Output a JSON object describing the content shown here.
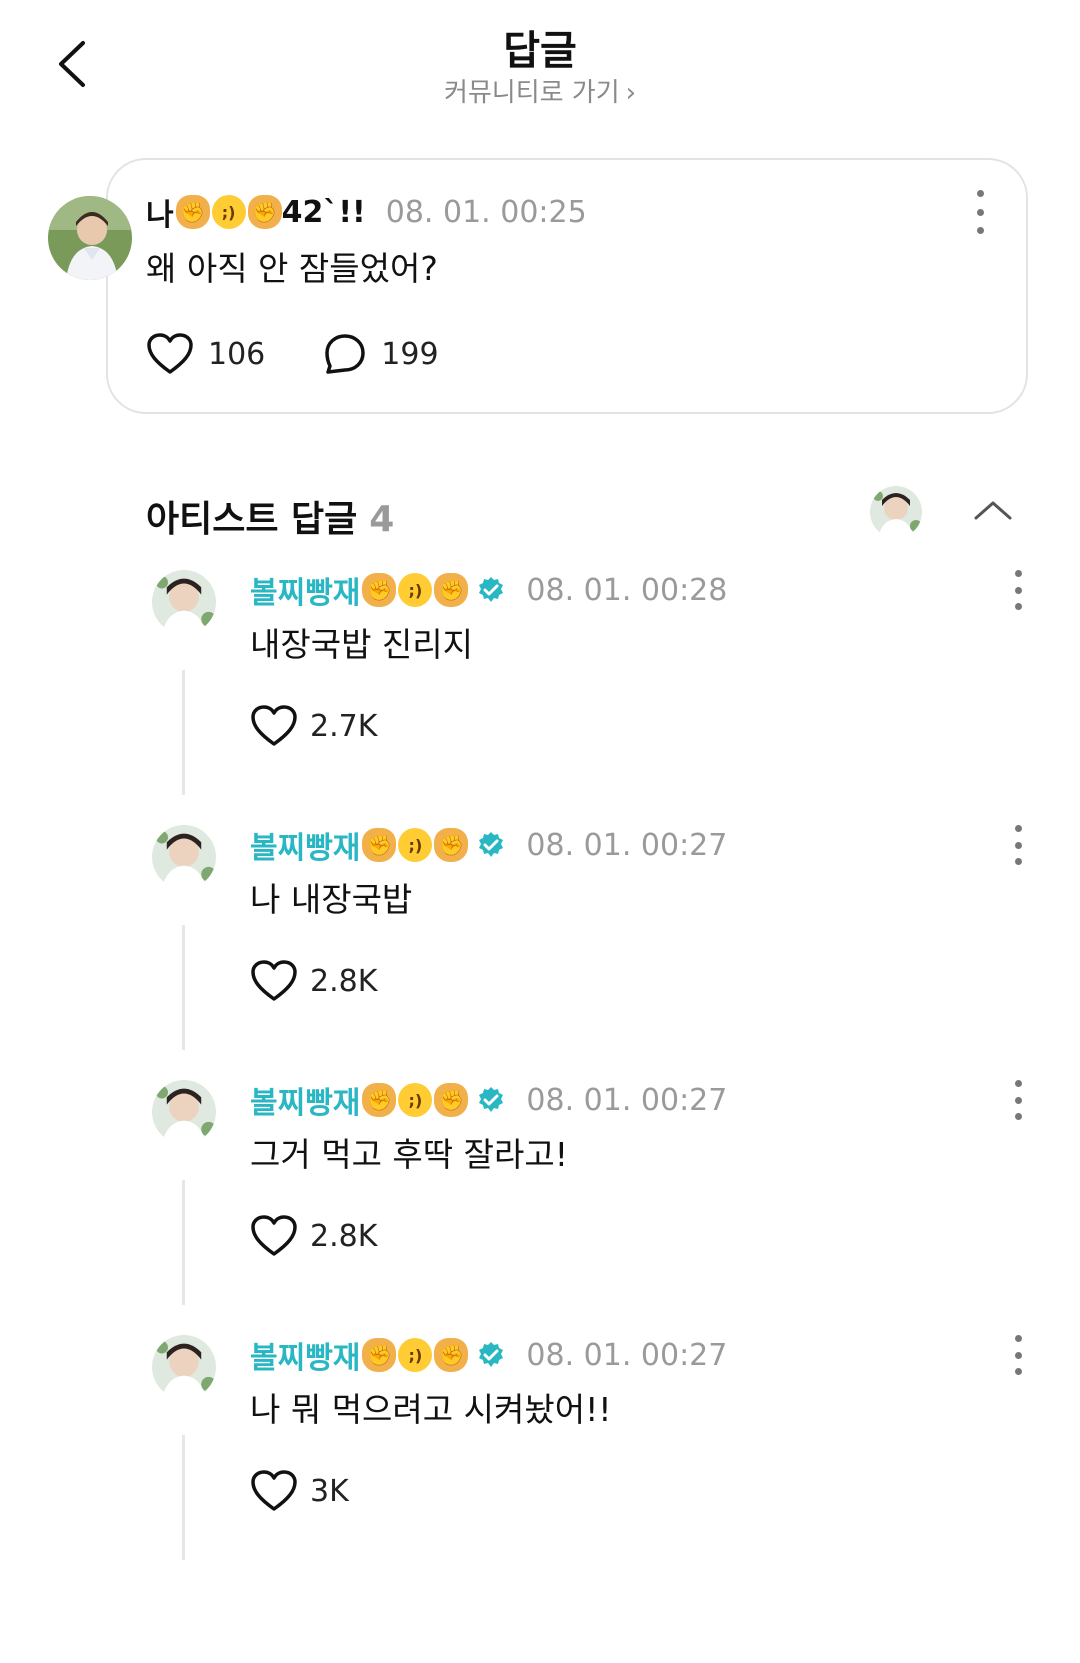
{
  "header": {
    "title": "답글",
    "community_link": "커뮤니티로 가기",
    "community_chevron": "›"
  },
  "original_post": {
    "author_prefix": "나",
    "author_emoji": [
      "fist",
      "wink",
      "fist"
    ],
    "author_suffix": "42`!!",
    "date": "08. 01. 00:25",
    "text": "왜 아직 안 잠들었어?",
    "likes": "106",
    "comments": "199",
    "avatar_icon": "profile-photo"
  },
  "artist_section": {
    "title": "아티스트 답글",
    "count": "4"
  },
  "replies": [
    {
      "author": "볼찌빵재",
      "date": "08. 01. 00:28",
      "text": "내장국밥 진리지",
      "likes": "2.7K"
    },
    {
      "author": "볼찌빵재",
      "date": "08. 01. 00:27",
      "text": "나 내장국밥",
      "likes": "2.8K"
    },
    {
      "author": "볼찌빵재",
      "date": "08. 01. 00:27",
      "text": "그거 먹고 후딱 잘라고!",
      "likes": "2.8K"
    },
    {
      "author": "볼찌빵재",
      "date": "08. 01. 00:27",
      "text": "나 뭐 먹으려고 시켜놨어!!",
      "likes": "3K"
    }
  ],
  "colors": {
    "artist_name": "#2ab7c4",
    "date_gray": "#9a9a9a",
    "card_border": "#e3e3e3",
    "verified": "#2ab7c4"
  }
}
